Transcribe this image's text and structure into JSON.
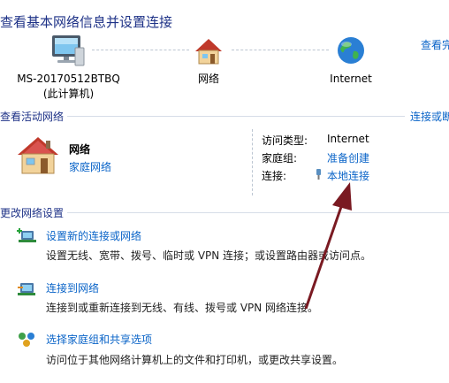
{
  "header": {
    "title": "查看基本网络信息并设置连接",
    "see_full_map": "查看完"
  },
  "map": {
    "computer": {
      "name": "MS-20170512BTBQ",
      "sub": "(此计算机)"
    },
    "network": {
      "name": "网络"
    },
    "internet": {
      "name": "Internet"
    }
  },
  "active": {
    "heading": "查看活动网络",
    "connect_link": "连接或断",
    "network_name": "网络",
    "network_type": "家庭网络",
    "access_type_label": "访问类型:",
    "access_type_value": "Internet",
    "homegroup_label": "家庭组:",
    "homegroup_value": "准备创建",
    "connections_label": "连接:",
    "connections_value": "本地连接"
  },
  "change": {
    "heading": "更改网络设置",
    "tasks": [
      {
        "title": "设置新的连接或网络",
        "desc": "设置无线、宽带、拨号、临时或 VPN 连接；或设置路由器或访问点。"
      },
      {
        "title": "连接到网络",
        "desc": "连接到或重新连接到无线、有线、拨号或 VPN 网络连接。"
      },
      {
        "title": "选择家庭组和共享选项",
        "desc": "访问位于其他网络计算机上的文件和打印机，或更改共享设置。"
      }
    ]
  },
  "colors": {
    "link": "#0a64c8",
    "heading": "#1e3287",
    "arrow": "#7a1a22"
  }
}
